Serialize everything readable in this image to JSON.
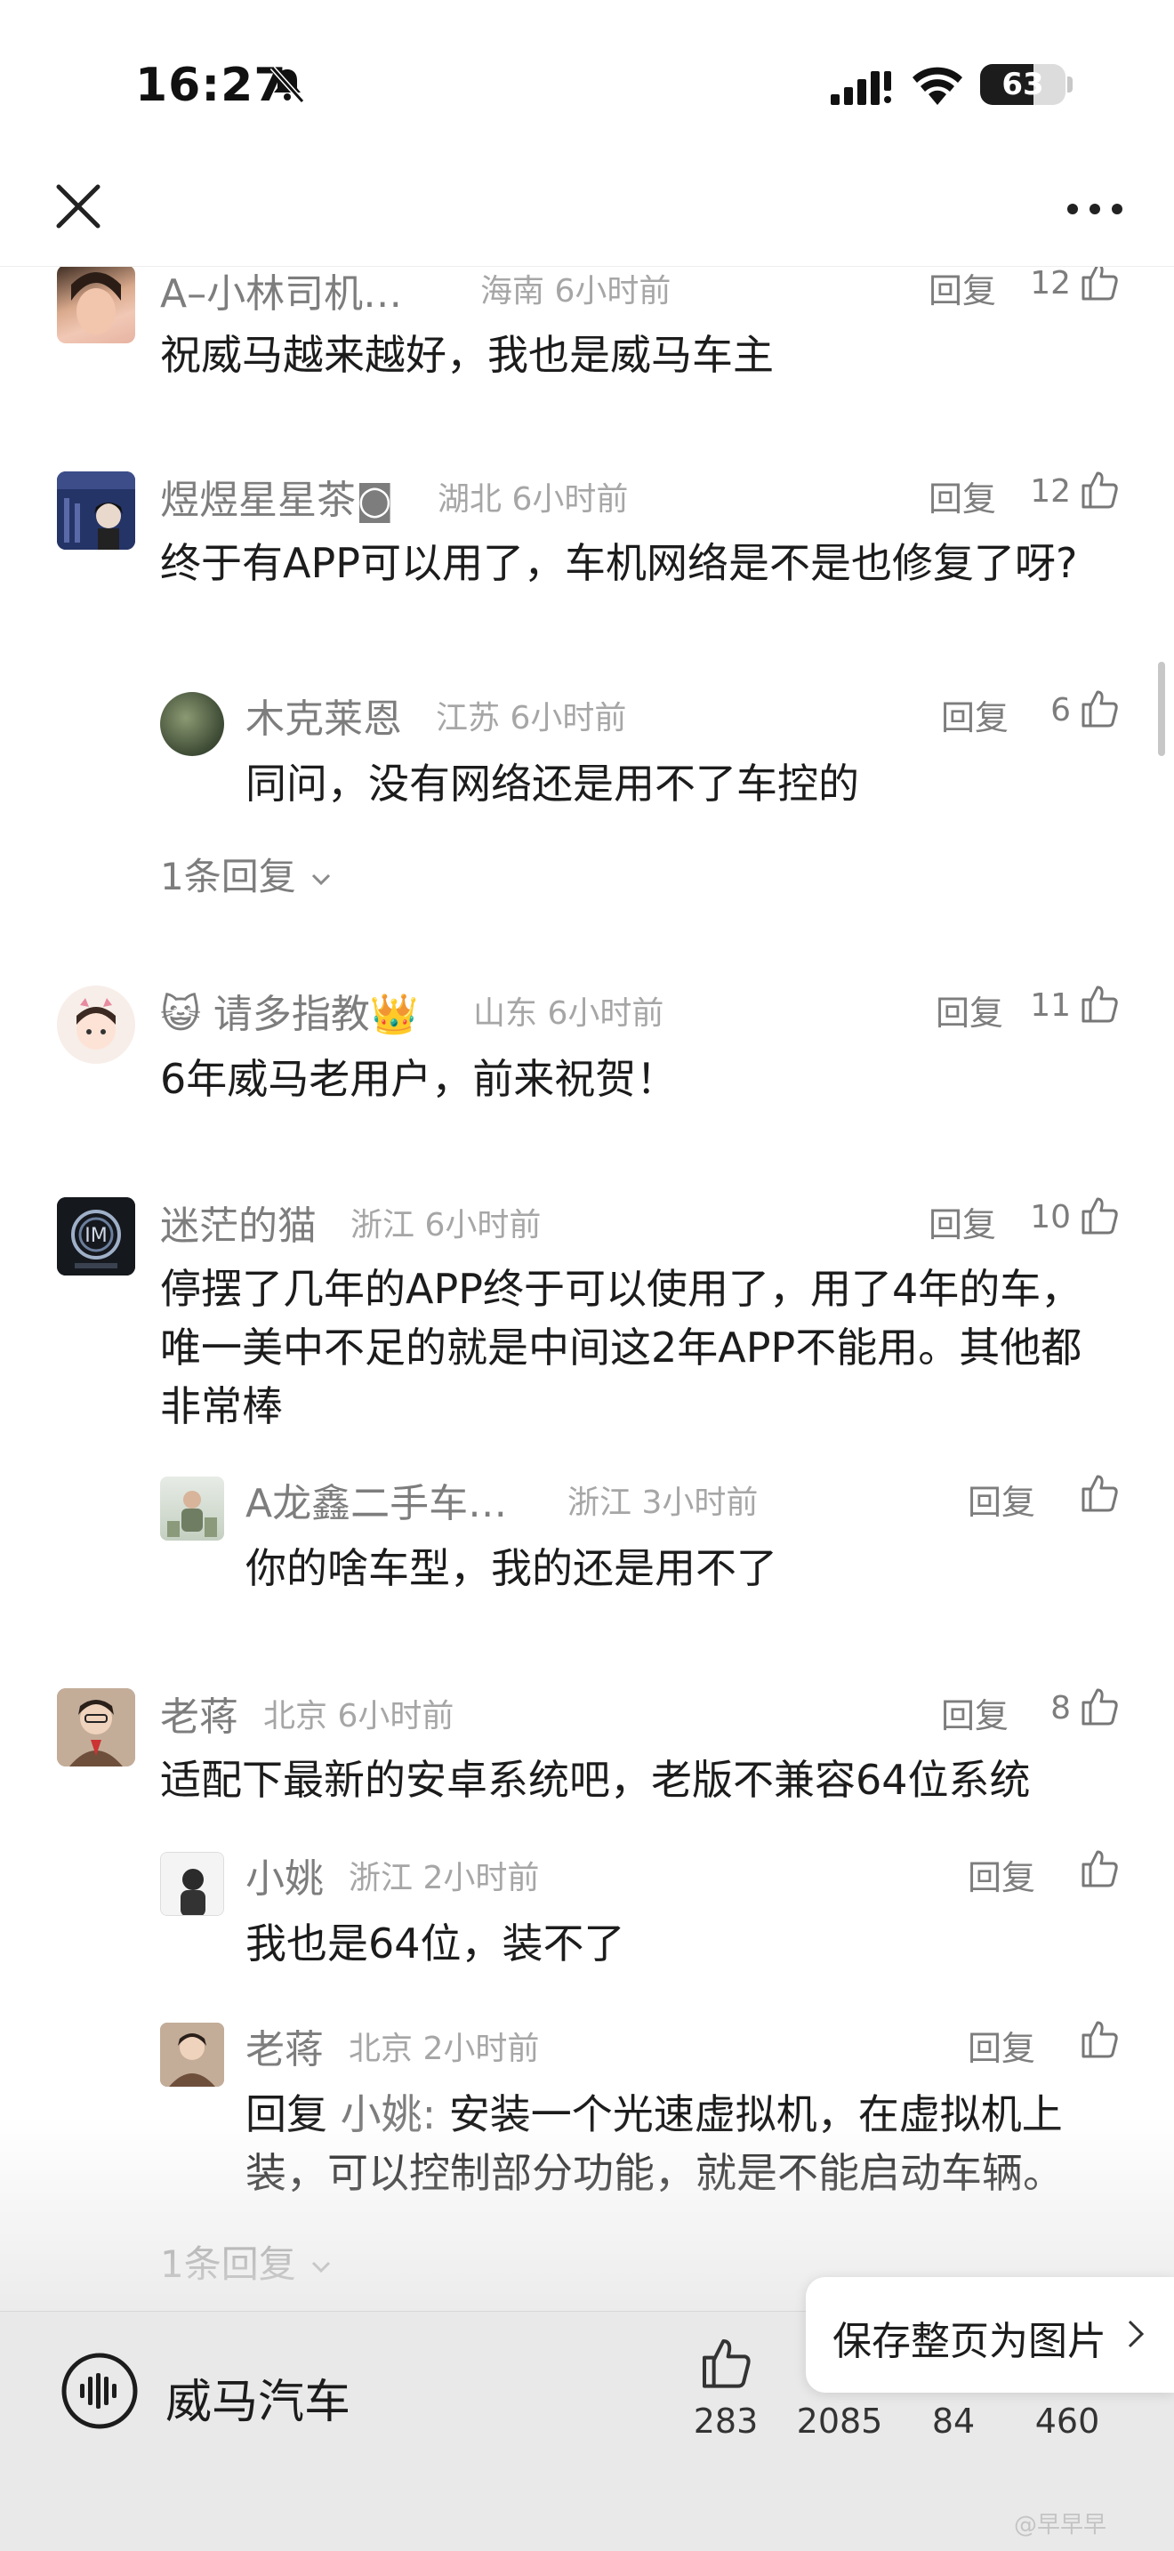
{
  "status_bar": {
    "time": "16:27",
    "battery": "63",
    "battery_level": 0.63
  },
  "top_bar": {
    "close_icon": "close-icon",
    "more_icon": "more-icon"
  },
  "comments": [
    {
      "name": "A–小林司机…",
      "meta": "海南 6小时前",
      "reply": "回复",
      "likes": "12",
      "text": "祝威马越来越好，我也是威马车主"
    },
    {
      "name": "煜煜星星茶◙",
      "meta": "湖北 6小时前",
      "reply": "回复",
      "likes": "12",
      "text": "终于有APP可以用了，车机网络是不是也修复了呀?",
      "sub": {
        "name": "木克莱恩",
        "meta": "江苏 6小时前",
        "reply": "回复",
        "likes": "6",
        "text": "同问，没有网络还是用不了车控的"
      },
      "more": "1条回复"
    },
    {
      "name": "😺 请多指教👑",
      "meta": "山东 6小时前",
      "reply": "回复",
      "likes": "11",
      "text": "6年威马老用户，前来祝贺！"
    },
    {
      "name": "迷茫的猫",
      "meta": "浙江 6小时前",
      "reply": "回复",
      "likes": "10",
      "text": "停摆了几年的APP终于可以使用了，用了4年的车，唯一美中不足的就是中间这2年APP不能用。其他都非常棒",
      "sub": {
        "name": "A龙鑫二手车…",
        "meta": "浙江 3小时前",
        "reply": "回复",
        "likes": "",
        "text": "你的啥车型，我的还是用不了"
      }
    },
    {
      "name": "老蒋",
      "meta": "北京 6小时前",
      "reply": "回复",
      "likes": "8",
      "text": "适配下最新的安卓系统吧，老版不兼容64位系统",
      "sub": {
        "name": "小姚",
        "meta": "浙江 2小时前",
        "reply": "回复",
        "likes": "",
        "text": "我也是64位，装不了"
      },
      "sub2": {
        "name": "老蒋",
        "meta": "北京 2小时前",
        "reply": "回复",
        "likes": "",
        "prefix": "回复 ",
        "reply_to": "小姚:",
        "text": " 安装一个光速虚拟机，在虚拟机上装，可以控制部分功能，就是不能启动车辆。"
      },
      "more": "1条回复"
    }
  ],
  "bottom_bar": {
    "brand": "威马汽车",
    "stats": [
      "283",
      "2085",
      "84",
      "460"
    ],
    "save_label": "保存整页为图片",
    "watermark": "@早早早"
  },
  "colors": {
    "accent_text": "#7d7d7d",
    "meta_text": "#a6a6a6",
    "body_text": "#1c1c1c",
    "bottom_bg": "#e9e9e9"
  }
}
